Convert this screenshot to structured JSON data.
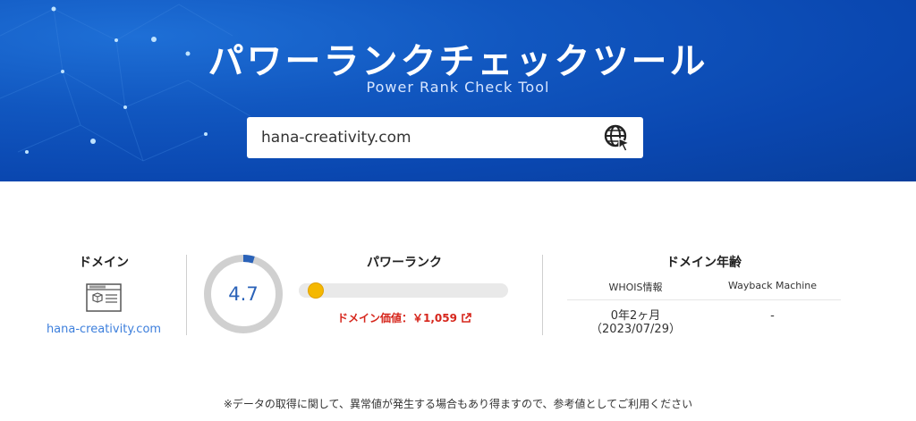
{
  "header": {
    "title": "パワーランクチェックツール",
    "subtitle": "Power Rank Check Tool"
  },
  "search": {
    "value": "hana-creativity.com",
    "button_icon": "globe-cursor-icon"
  },
  "domain_column": {
    "label": "ドメイン",
    "icon": "website-icon",
    "domain": "hana-creativity.com"
  },
  "power_rank": {
    "label": "パワーランク",
    "score": "4.7",
    "score_fraction": 0.047,
    "domain_value_text": "ドメイン価値：￥1,059",
    "link_icon": "external-link-icon",
    "colors": {
      "gauge_fill": "#2a62b8",
      "gauge_track": "#d0d0d0",
      "knob": "#f5b800",
      "value_text": "#d6261c"
    }
  },
  "domain_age": {
    "label": "ドメイン年齢",
    "columns": [
      "WHOIS情報",
      "Wayback Machine"
    ],
    "whois_age": "0年2ヶ月",
    "whois_date": "（2023/07/29）",
    "wayback": "-"
  },
  "note": "※データの取得に関して、異常値が発生する場合もあり得ますので、参考値としてご利用ください"
}
